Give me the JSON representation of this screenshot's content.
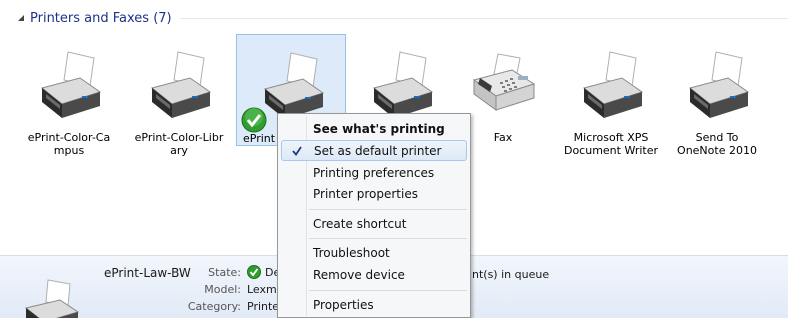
{
  "group": {
    "title": "Printers and Faxes (7)",
    "expander_icon": "collapse-triangle-icon"
  },
  "devices": [
    {
      "name": "ePrint-Color-Ca\nmpus",
      "icon": "printer-icon",
      "selected": false
    },
    {
      "name": "ePrint-Color-Libr\nary",
      "icon": "printer-icon",
      "selected": false
    },
    {
      "name": "ePrint",
      "icon": "printer-icon",
      "selected": true,
      "default": true
    },
    {
      "name": "",
      "icon": "printer-icon",
      "selected": false
    },
    {
      "name": "Fax",
      "icon": "fax-icon",
      "selected": false
    },
    {
      "name": "Microsoft XPS\nDocument Writer",
      "icon": "printer-icon",
      "selected": false
    },
    {
      "name": "Send To\nOneNote 2010",
      "icon": "printer-icon",
      "selected": false
    }
  ],
  "context_menu": {
    "items": [
      {
        "label": "See what's printing",
        "bold": true
      },
      {
        "label": "Set as default printer",
        "checked": true,
        "highlighted": true
      },
      {
        "label": "Printing preferences"
      },
      {
        "label": "Printer properties"
      },
      {
        "label": "Create shortcut"
      },
      {
        "label": "Troubleshoot"
      },
      {
        "label": "Remove device"
      },
      {
        "label": "Properties"
      }
    ]
  },
  "details": {
    "device_name": "ePrint-Law-BW",
    "state_label": "State:",
    "state_value": "De",
    "model_label": "Model:",
    "model_value": "Lexma",
    "category_label": "Category:",
    "category_value": "Printe",
    "queue_text": "nt(s) in queue"
  },
  "colors": {
    "accent": "#1e3287",
    "selection": "#dceaf9",
    "check_green": "#2f9e2f"
  }
}
